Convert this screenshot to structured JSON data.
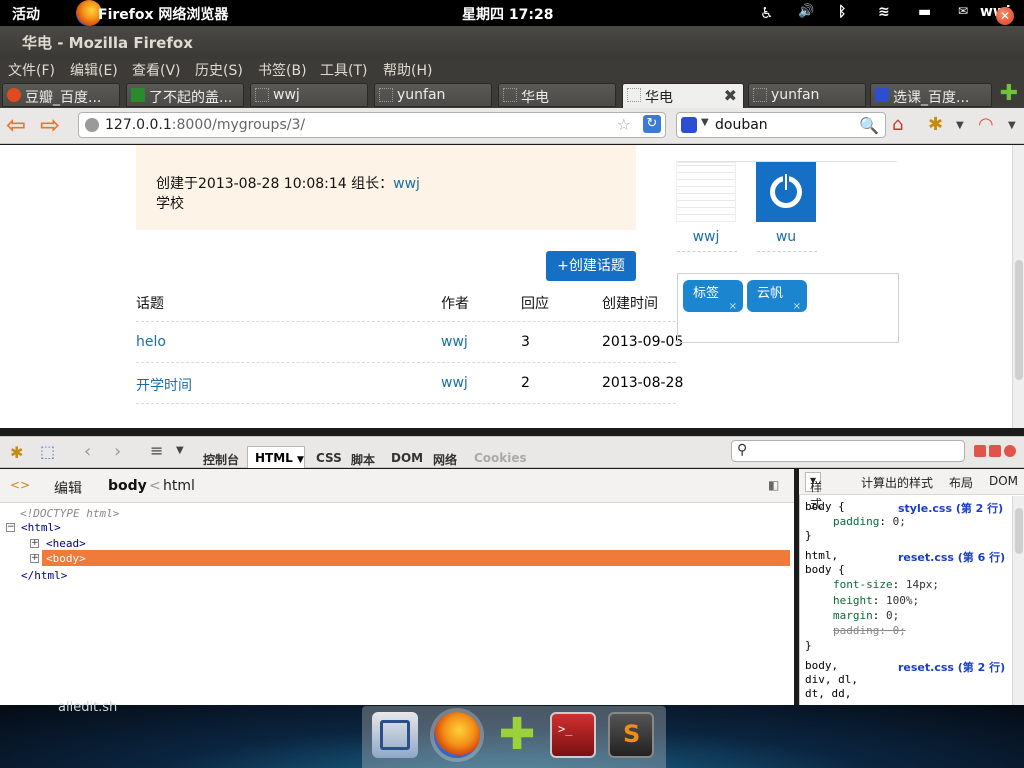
{
  "topbar": {
    "activities": "活动",
    "app_name": "Firefox 网络浏览器",
    "clock": "星期四 17:28",
    "user": "wwj"
  },
  "window": {
    "title": "华电 - Mozilla Firefox"
  },
  "menu": [
    "文件(F)",
    "编辑(E)",
    "查看(V)",
    "历史(S)",
    "书签(B)",
    "工具(T)",
    "帮助(H)"
  ],
  "tabs": [
    {
      "label": "豆瓣_百度..."
    },
    {
      "label": "了不起的盖..."
    },
    {
      "label": "wwj"
    },
    {
      "label": "yunfan"
    },
    {
      "label": "华电"
    },
    {
      "label": "华电",
      "active": true
    },
    {
      "label": "yunfan"
    },
    {
      "label": "选课_百度..."
    }
  ],
  "nav": {
    "url_host": "127.0.0.1",
    "url_rest": ":8000/mygroups/3/",
    "search_query": "douban"
  },
  "page": {
    "created_prefix": "创建于2013-08-28 10:08:14 组长：",
    "leader": "wwj",
    "group_desc": "学校",
    "create_topic_button": "+创建话题",
    "table_headers": [
      "话题",
      "作者",
      "回应",
      "创建时间"
    ],
    "rows": [
      {
        "topic": "helo",
        "author": "wwj",
        "replies": "3",
        "date": "2013-09-05"
      },
      {
        "topic": "开学时间",
        "author": "wwj",
        "replies": "2",
        "date": "2013-08-28"
      }
    ],
    "members": [
      {
        "name": "wwj"
      },
      {
        "name": "wu"
      }
    ],
    "tags": [
      "标签",
      "云帆"
    ],
    "tag_remove": "×"
  },
  "firebug": {
    "tabs": [
      "控制台",
      "HTML",
      "CSS",
      "脚本",
      "DOM",
      "网络",
      "Cookies"
    ],
    "edit_label": "编辑",
    "breadcrumb_current": "body",
    "breadcrumb_sep": "<",
    "breadcrumb_parent": "html",
    "tree": {
      "doctype": "<!DOCTYPE html>",
      "html_open": "<html>",
      "head": "<head>",
      "body": "<body>",
      "html_close": "</html>"
    },
    "side_tabs": [
      "样式",
      "计算出的样式",
      "布局",
      "DOM"
    ],
    "css_rules": {
      "r1_selector": "body {",
      "r1_source": "style.css (第 2 行)",
      "r1_prop": "padding",
      "r1_val": "0;",
      "close": "}",
      "r2_selector_1": "html,",
      "r2_selector_2": "body {",
      "r2_source": "reset.css (第 6 行)",
      "r2_props": [
        {
          "prop": "font-size",
          "val": "14px;"
        },
        {
          "prop": "height",
          "val": "100%;"
        },
        {
          "prop": "margin",
          "val": "0;"
        },
        {
          "prop": "padding",
          "val": "0;",
          "overridden": true
        }
      ],
      "r3_selector_1": "body,",
      "r3_selector_2": "div, dl,",
      "r3_selector_3": "dt, dd,",
      "r3_source": "reset.css (第 2 行)"
    }
  },
  "desktop": {
    "label": "alledit.sh"
  }
}
